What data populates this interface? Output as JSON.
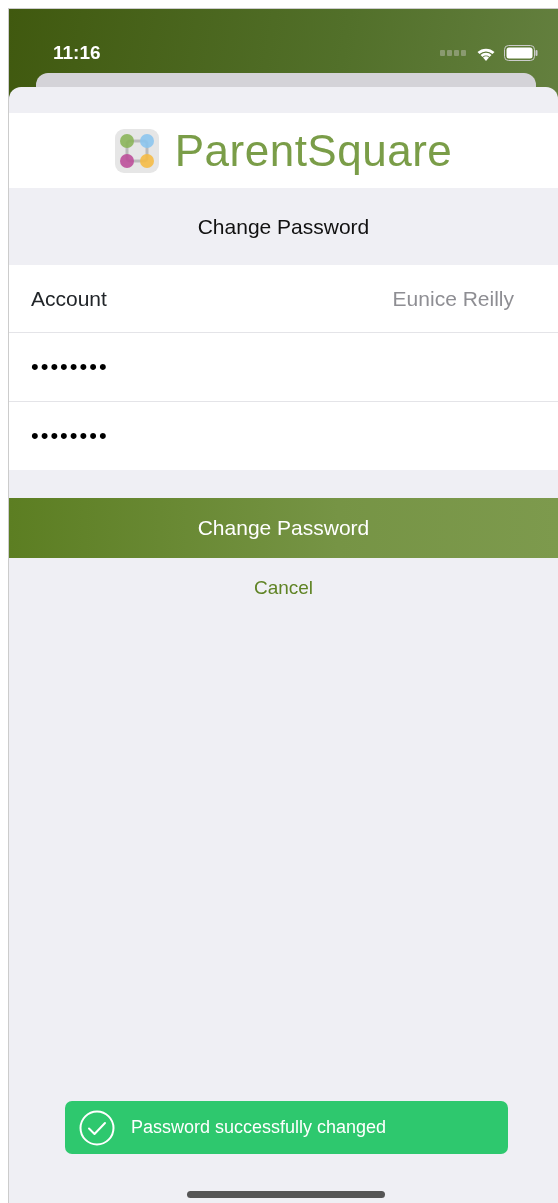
{
  "status_bar": {
    "time": "11:16"
  },
  "logo": {
    "text": "ParentSquare"
  },
  "header": {
    "title": "Change Password"
  },
  "form": {
    "rows": [
      {
        "kind": "info",
        "label": "Account",
        "value": "Eunice Reilly"
      },
      {
        "kind": "password",
        "value": "••••••••"
      },
      {
        "kind": "password",
        "value": "••••••••"
      }
    ]
  },
  "primary_button": {
    "label": "Change Password"
  },
  "cancel_link": {
    "label": "Cancel"
  },
  "toast": {
    "message": "Password successfully changed"
  }
}
